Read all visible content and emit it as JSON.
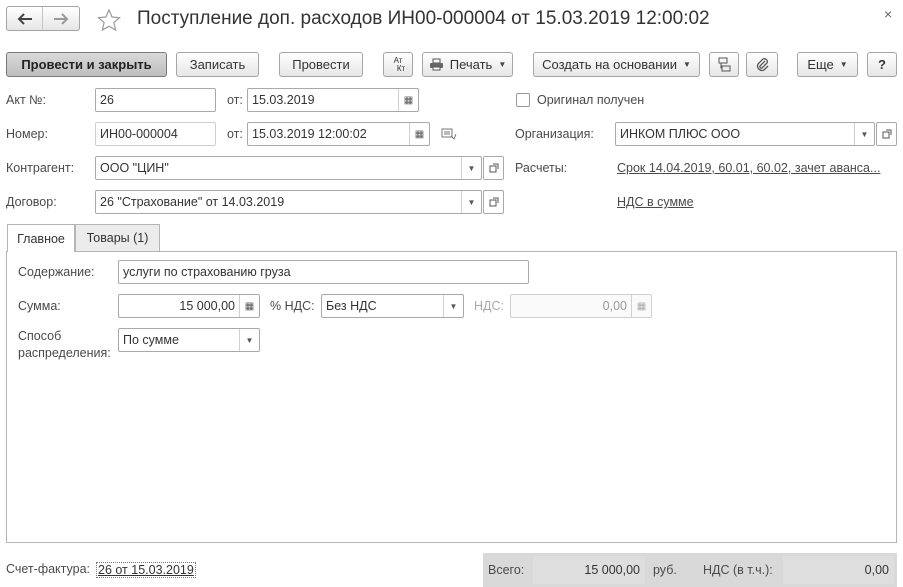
{
  "header": {
    "title": "Поступление доп. расходов ИН00-000004 от 15.03.2019 12:00:02",
    "back_icon": "arrow-left-icon",
    "forward_icon": "arrow-right-icon",
    "favorite_icon": "star-icon",
    "close_icon": "close-icon"
  },
  "toolbar": {
    "post_close": "Провести и закрыть",
    "save": "Записать",
    "post": "Провести",
    "dt_kt_top": "Ат",
    "dt_kt_bottom": "Кт",
    "print": "Печать",
    "create_based": "Создать на основании",
    "more": "Еще",
    "help": "?"
  },
  "form": {
    "act_label": "Акт №:",
    "act_value": "26",
    "act_date_label": "от:",
    "act_date_value": "15.03.2019",
    "original_label": "Оригинал получен",
    "original_checked": false,
    "number_label": "Номер:",
    "number_value": "ИН00-000004",
    "number_date_label": "от:",
    "number_date_value": "15.03.2019 12:00:02",
    "org_label": "Организация:",
    "org_value": "ИНКОМ ПЛЮС ООО",
    "counterparty_label": "Контрагент:",
    "counterparty_value": "ООО \"ЦИН\"",
    "settlements_label": "Расчеты:",
    "settlements_link": "Срок 14.04.2019, 60.01, 60.02, зачет аванса...",
    "contract_label": "Договор:",
    "contract_value": "26 \"Страхование\" от 14.03.2019",
    "vat_link": "НДС в сумме"
  },
  "tabs": [
    {
      "label": "Главное",
      "active": true
    },
    {
      "label": "Товары (1)",
      "active": false
    }
  ],
  "main_tab": {
    "content_label": "Содержание:",
    "content_value": "услуги по страхованию груза",
    "sum_label": "Сумма:",
    "sum_value": "15 000,00",
    "vat_rate_label": "% НДС:",
    "vat_rate_value": "Без НДС",
    "vat_label": "НДС:",
    "vat_value": "0,00",
    "distribution_label_1": "Способ",
    "distribution_label_2": "распределения:",
    "distribution_value": "По сумме"
  },
  "footer": {
    "invoice_label": "Счет-фактура:",
    "invoice_link": "26 от 15.03.2019",
    "total_label": "Всего:",
    "total_value": "15 000,00",
    "currency": "руб.",
    "vat_incl_label": "НДС (в т.ч.):",
    "vat_incl_value": "0,00"
  },
  "colors": {
    "footer_bg": "#d9d9d9",
    "primary_button_bg": "#c8c8c8",
    "border": "#a9a9a9"
  }
}
